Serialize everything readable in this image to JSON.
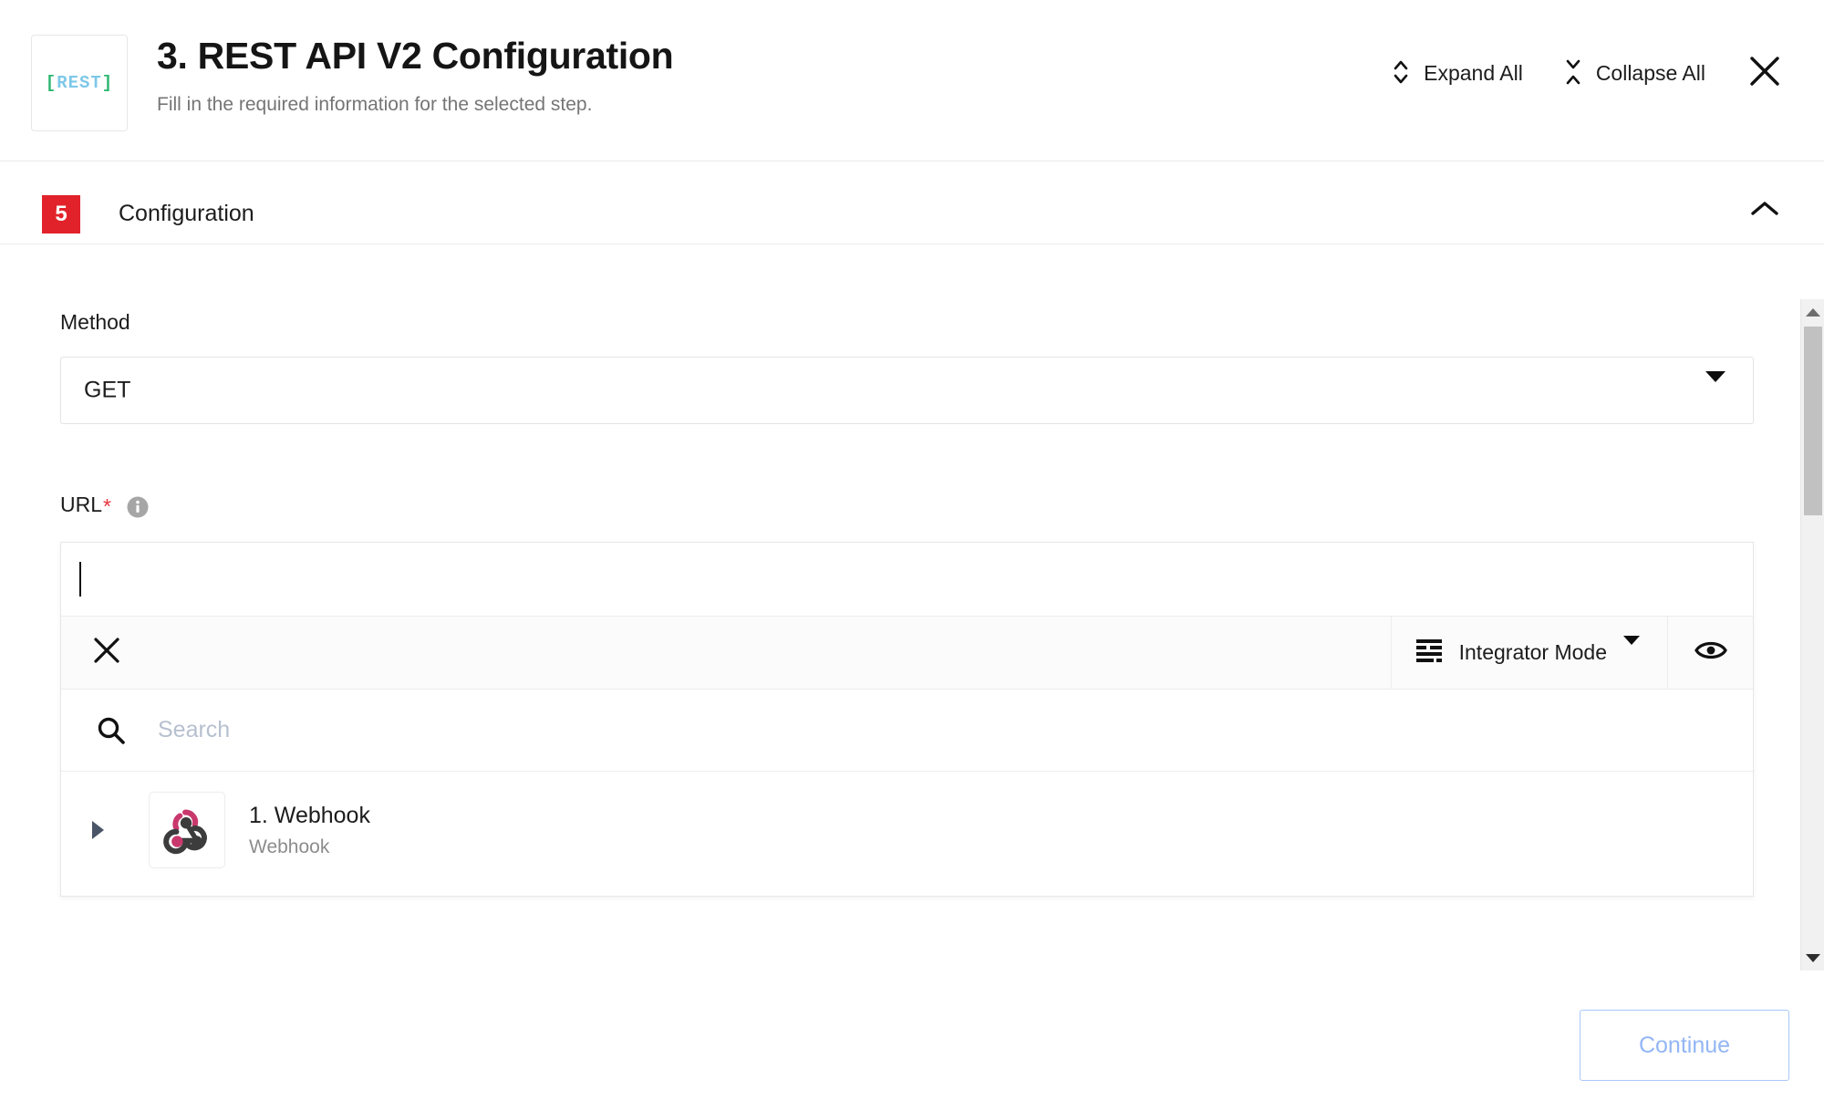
{
  "header": {
    "logo": {
      "bracket_left": "[",
      "word": "REST",
      "bracket_right": "]"
    },
    "title": "3. REST API V2 Configuration",
    "subtitle": "Fill in the required information for the selected step.",
    "expand_all_label": "Expand All",
    "collapse_all_label": "Collapse All",
    "close_label": "✕"
  },
  "section": {
    "badge_number": "5",
    "title": "Configuration"
  },
  "form": {
    "method": {
      "label": "Method",
      "value": "GET"
    },
    "url": {
      "label": "URL",
      "required_marker": "*",
      "value": "",
      "placeholder": ""
    }
  },
  "toolbar": {
    "clear_label": "✕",
    "mode_label": "Integrator Mode",
    "preview_label": "eye"
  },
  "search": {
    "placeholder": "Search",
    "value": ""
  },
  "list": {
    "items": [
      {
        "title": "1. Webhook",
        "subtitle": "Webhook"
      }
    ]
  },
  "footer": {
    "continue_label": "Continue"
  },
  "colors": {
    "badge_red": "#e2222a",
    "required_red": "#e8323c",
    "continue_blue": "#93b6f5",
    "logo_green": "#2eb872",
    "logo_blue": "#7ec8e8",
    "webhook_pink": "#c9386c",
    "webhook_dark": "#3c3c3c",
    "placeholder_grey": "#b6c0cf"
  }
}
